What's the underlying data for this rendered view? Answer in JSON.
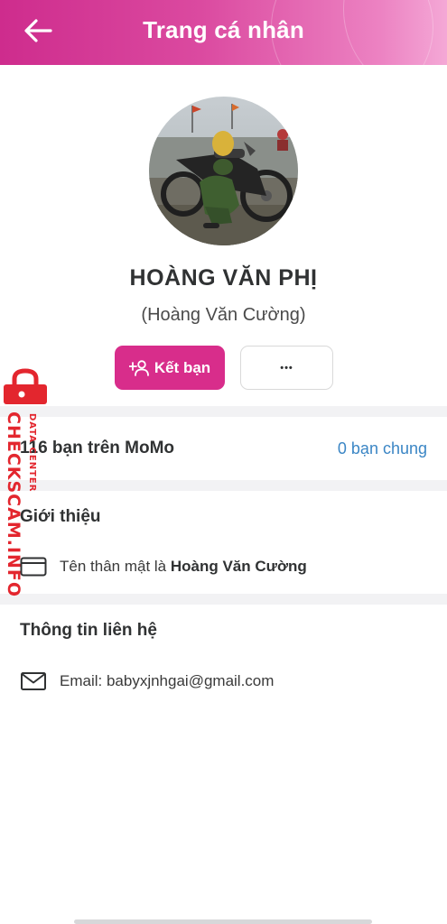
{
  "header": {
    "title": "Trang cá nhân",
    "back_icon": "arrow-left-icon",
    "gradient_colors": [
      "#ce2c8d",
      "#f4a8d6"
    ]
  },
  "profile": {
    "name": "HOÀNG VĂN PHỊ",
    "subname": "(Hoàng Văn Cường)",
    "avatar_icon": "profile-photo"
  },
  "actions": {
    "add_friend_label": "Kết bạn",
    "add_friend_icon": "add-person-icon",
    "more_label": "•••",
    "accent_color": "#d82d8b"
  },
  "friends": {
    "count_text": "116 bạn trên MoMo",
    "mutual_text": "0 bạn chung",
    "mutual_color": "#3b86c5"
  },
  "intro": {
    "title": "Giới thiệu",
    "nickname_prefix": "Tên thân mật là ",
    "nickname_value": "Hoàng Văn Cường",
    "icon": "id-card-icon"
  },
  "contact": {
    "title": "Thông tin liên hệ",
    "email_text": "Email: babyxjnhgai@gmail.com",
    "icon": "mail-icon"
  },
  "watermark": {
    "brand": "CHECKSCAM.INFO",
    "tag": "DATA CENTER",
    "icon": "padlock-icon",
    "color": "#e3262e"
  }
}
